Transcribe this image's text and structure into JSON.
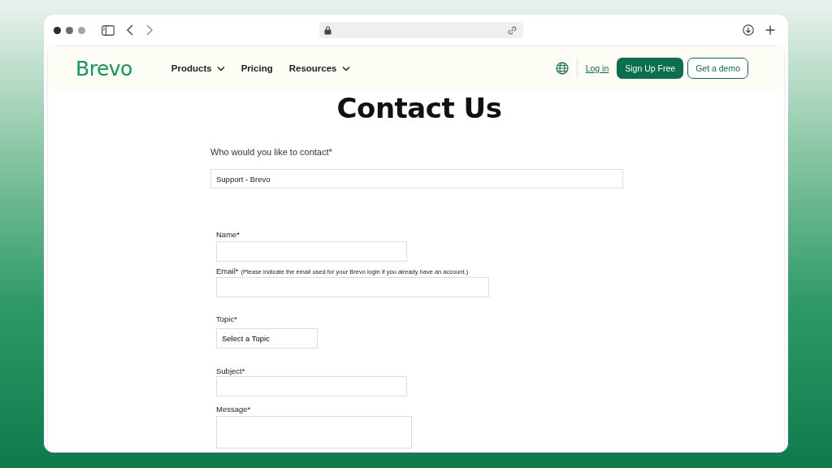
{
  "browser": {
    "url_bar": {
      "kind": "secure"
    }
  },
  "header": {
    "logo": "Brevo",
    "nav": [
      {
        "label": "Products",
        "dropdown": true
      },
      {
        "label": "Pricing",
        "dropdown": false
      },
      {
        "label": "Resources",
        "dropdown": true
      }
    ],
    "login": "Log in",
    "signup": "Sign Up Free",
    "demo": "Get a demo"
  },
  "page": {
    "title": "Contact Us",
    "contact": {
      "label": "Who would you like to contact*",
      "value": "Support - Brevo"
    },
    "fields": [
      {
        "kind": "text",
        "label": "Name*"
      },
      {
        "kind": "text",
        "label": "Email*",
        "note": "(Please indicate the email used for your Brevo login if you already have an account.)"
      },
      {
        "kind": "select",
        "label": "Topic*",
        "value": "Select a Topic"
      },
      {
        "kind": "text",
        "label": "Subject*"
      },
      {
        "kind": "textarea",
        "label": "Message*"
      }
    ]
  }
}
